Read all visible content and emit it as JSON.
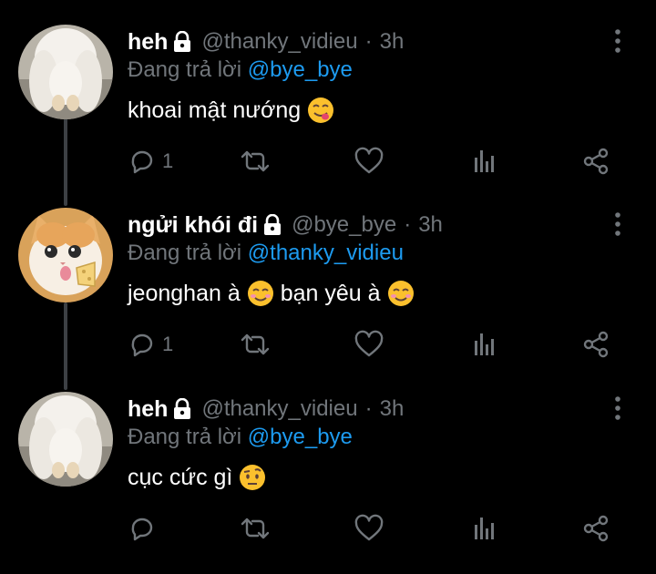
{
  "colors": {
    "background": "#000000",
    "name": "#ffffff",
    "muted": "#71767b",
    "mention": "#1d9bf0",
    "thread_line": "#3d4044"
  },
  "tweets": [
    {
      "name": "heh",
      "handle": "@thanky_vidieu",
      "separator": "·",
      "time": "3h",
      "reply_prefix": "Đang trả lời",
      "reply_to": "@bye_bye",
      "text": "khoai mật nướng",
      "emoji": "face-savoring-food",
      "reply_count": "1",
      "avatar": "white-bunny-avatar"
    },
    {
      "name": "ngửi khói đi",
      "handle": "@bye_bye",
      "separator": "·",
      "time": "3h",
      "reply_prefix": "Đang trả lời",
      "reply_to": "@thanky_vidieu",
      "text_a": "jeonghan à",
      "text_b": "bạn yêu à",
      "emoji": "smiling-face",
      "reply_count": "1",
      "avatar": "kitten-eating-cheese-avatar"
    },
    {
      "name": "heh",
      "handle": "@thanky_vidieu",
      "separator": "·",
      "time": "3h",
      "reply_prefix": "Đang trả lời",
      "reply_to": "@bye_bye",
      "text": "cục cức gì",
      "emoji": "face-with-raised-eyebrow",
      "reply_count": "",
      "avatar": "white-bunny-avatar"
    }
  ],
  "icons": [
    "lock-icon",
    "more-icon",
    "reply-icon",
    "retweet-icon",
    "like-icon",
    "views-icon",
    "share-icon"
  ]
}
